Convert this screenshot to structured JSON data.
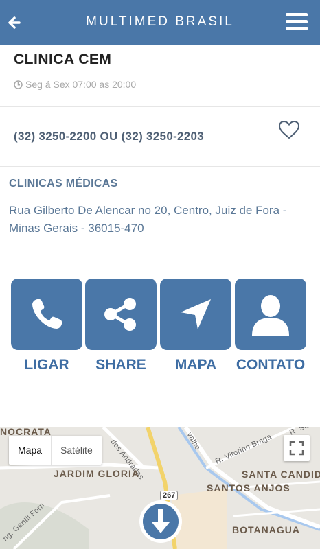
{
  "app": {
    "title": "MULTIMED BRASIL"
  },
  "icons": {
    "back": "arrow-left-icon",
    "menu": "hamburger-menu-icon",
    "clock": "clock-icon",
    "favorite": "heart-outline-icon"
  },
  "clinic": {
    "name": "CLINICA CEM",
    "hours": "Seg á Sex 07:00 as 20:00",
    "phones": "(32) 3250-2200 OU (32) 3250-2203",
    "category": "CLINICAS MÉDICAS",
    "address": "Rua Gilberto De Alencar no 20, Centro, Juiz de Fora - Minas Gerais - 36015-470"
  },
  "actions": [
    {
      "label": "LIGAR",
      "icon": "phone-icon"
    },
    {
      "label": "SHARE",
      "icon": "share-icon"
    },
    {
      "label": "MAPA",
      "icon": "navigation-arrow-icon"
    },
    {
      "label": "CONTATO",
      "icon": "user-icon"
    }
  ],
  "map": {
    "type_map": "Mapa",
    "type_satellite": "Satélite",
    "labels": {
      "nocrata": "NOCRATA",
      "jardim_gloria": "JARDIM GLORIA",
      "santa_candida": "SANTA CANDID",
      "santos_anjos": "SANTOS ANJOS",
      "botanagua": "BOTANAGUA",
      "r_vitorino": "R. Vitorino Braga",
      "r_sao": "R. São J",
      "dos_andradas": "dos Andradas",
      "gentil": "ng. Gentil Forn",
      "carvalho": "valho",
      "route": "267"
    }
  },
  "colors": {
    "primary": "#4a77a8",
    "text_dark": "#222222",
    "text_secondary": "#5a7796"
  }
}
